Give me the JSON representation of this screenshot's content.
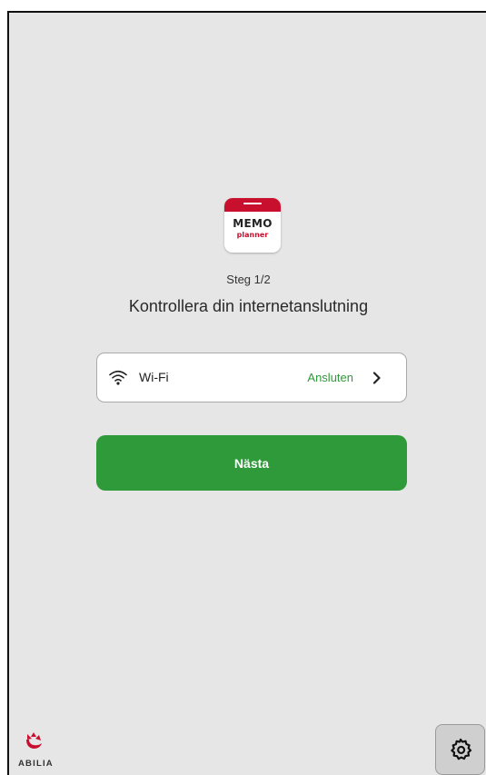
{
  "app": {
    "icon_word_top": "MEMO",
    "icon_word_bottom": "planner",
    "brand_color": "#c8102e"
  },
  "wizard": {
    "step": "Steg 1/2",
    "title": "Kontrollera din internetanslutning"
  },
  "wifi": {
    "icon": "wifi-icon",
    "label": "Wi-Fi",
    "status": "Ansluten",
    "status_color": "#2e9a38",
    "chevron": "chevron-right-icon"
  },
  "actions": {
    "next_label": "Nästa",
    "next_color": "#2f9a3a"
  },
  "footer": {
    "logo_text": "ABILIA",
    "settings_icon": "gear-icon"
  }
}
